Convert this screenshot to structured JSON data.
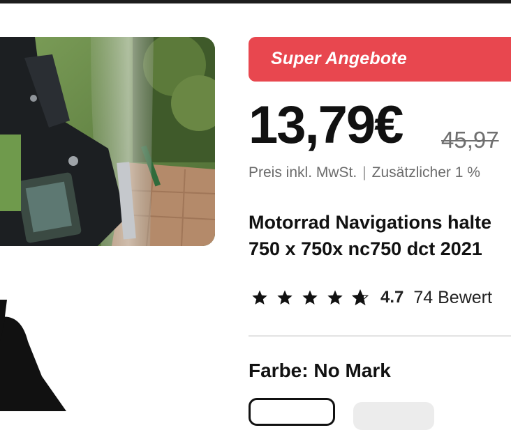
{
  "promo": {
    "label": "Super Angebote",
    "color": "#e8474f"
  },
  "price": {
    "current": "13,79€",
    "original": "45,97"
  },
  "tax": {
    "included": "Preis inkl. MwSt.",
    "separator": "|",
    "extra": "Zusätzlicher 1 %"
  },
  "product": {
    "title_line1": "Motorrad Navigations halte",
    "title_line2": "750 x 750x nc750 dct 2021"
  },
  "rating": {
    "value": "4.7",
    "reviews": "74 Bewert",
    "stars": 4.7
  },
  "variant": {
    "label": "Farbe: No Mark"
  },
  "icons": {
    "star": "star-icon",
    "half_star": "half-star-icon"
  }
}
